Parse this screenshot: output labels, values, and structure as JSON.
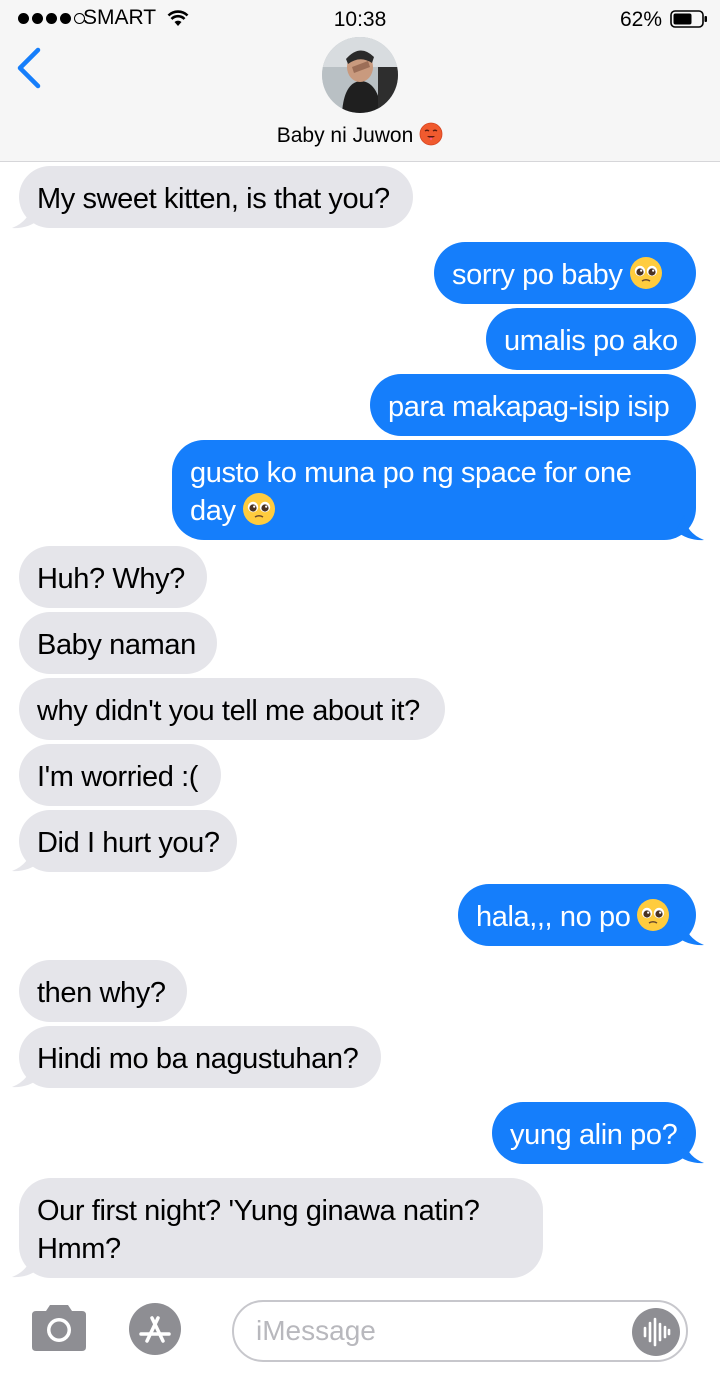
{
  "status_bar": {
    "carrier": "SMART",
    "time": "10:38",
    "battery": "62%"
  },
  "header": {
    "contact_name": "Baby ni Juwon"
  },
  "messages": [
    {
      "from": "them",
      "text": "My sweet kitten, is that you?"
    },
    {
      "from": "me",
      "text": "sorry po baby"
    },
    {
      "from": "me",
      "text": "umalis po ako"
    },
    {
      "from": "me",
      "text": "para makapag-isip isip"
    },
    {
      "from": "me",
      "text": "gusto ko muna po ng space for one day"
    },
    {
      "from": "them",
      "text": "Huh? Why?"
    },
    {
      "from": "them",
      "text": "Baby naman"
    },
    {
      "from": "them",
      "text": "why didn't you tell me about it?"
    },
    {
      "from": "them",
      "text": "I'm worried :("
    },
    {
      "from": "them",
      "text": "Did I hurt you?"
    },
    {
      "from": "me",
      "text": "hala,,, no po"
    },
    {
      "from": "them",
      "text": "then why?"
    },
    {
      "from": "them",
      "text": "Hindi mo ba nagustuhan?"
    },
    {
      "from": "me",
      "text": "yung alin po?"
    },
    {
      "from": "them",
      "text": "Our first night? 'Yung ginawa natin? Hmm?"
    }
  ],
  "composer": {
    "placeholder": "iMessage"
  },
  "colors": {
    "outgoing": "#157efb",
    "incoming": "#e5e5ea",
    "ios_blue": "#157efb"
  }
}
